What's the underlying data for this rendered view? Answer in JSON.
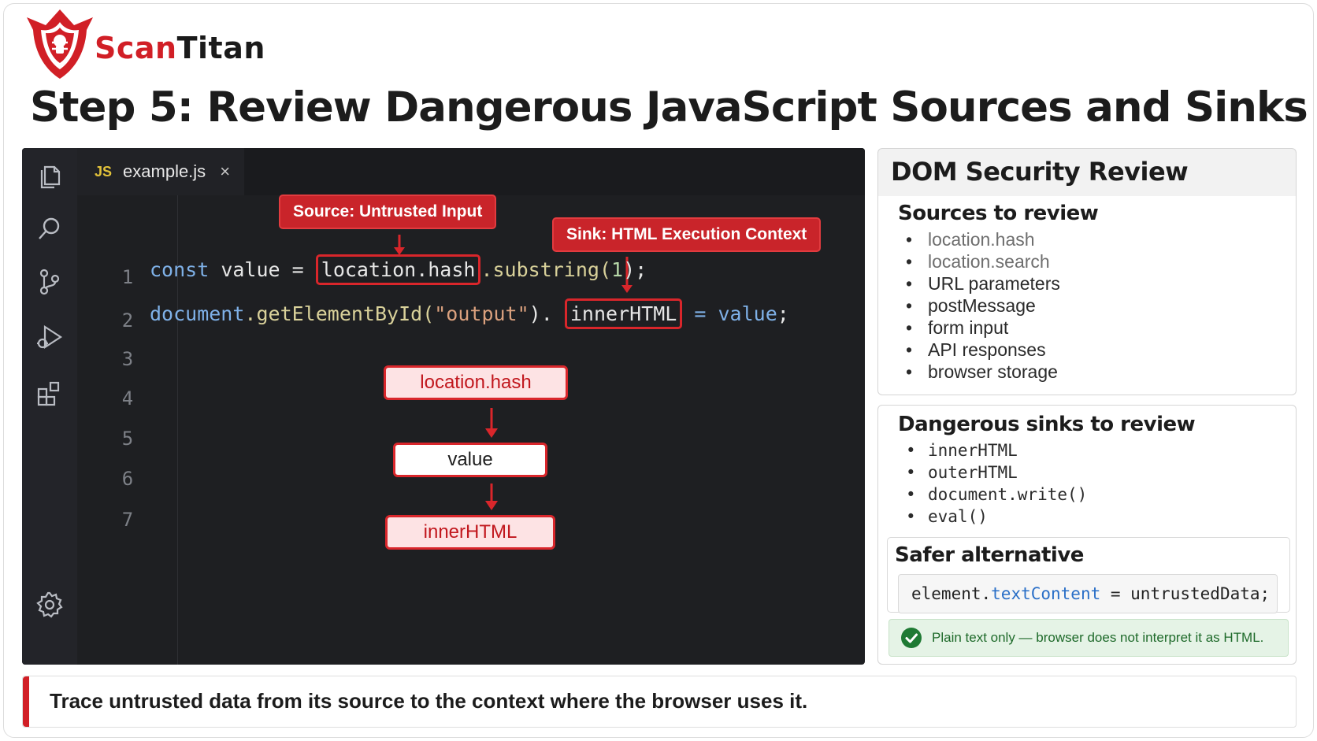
{
  "brand": {
    "name_part1": "Scan",
    "name_part2": "Titan",
    "shield_icon": "shield-bug-icon"
  },
  "title": "Step 5: Review Dangerous JavaScript Sources and Sinks",
  "editor": {
    "tab": {
      "lang_badge": "JS",
      "filename": "example.js",
      "close_glyph": "×"
    },
    "activity_icons": [
      "explorer-icon",
      "search-icon",
      "source-control-icon",
      "run-debug-icon",
      "extensions-icon",
      "settings-gear-icon"
    ],
    "line_numbers": [
      "1",
      "2",
      "3",
      "4",
      "5",
      "6",
      "7"
    ],
    "line1": {
      "kw": "const",
      "var": "value",
      "eq": "=",
      "hl": "location.hash",
      "fn": ".substring(",
      "num": "1",
      "end": ");"
    },
    "line2": {
      "obj": "document",
      "fn": ".getElementById(",
      "str": "\"output\"",
      "close": ").",
      "hl": "innerHTML",
      "eq": "=",
      "var": "value",
      "end": ";"
    },
    "callouts": {
      "source": "Source: Untrusted Input",
      "sink": "Sink: HTML Execution Context"
    },
    "flow": {
      "step1": "location.hash",
      "step2": "value",
      "step3": "innerHTML"
    }
  },
  "panel": {
    "title": "DOM Security Review",
    "sources_title": "Sources to review",
    "sources": [
      "location.hash",
      "location.search",
      "URL parameters",
      "postMessage",
      "form input",
      "API responses",
      "browser storage"
    ],
    "sinks_title": "Dangerous sinks to review",
    "sinks": [
      "innerHTML",
      "outerHTML",
      "document.write()",
      "eval()"
    ],
    "safer_title": "Safer alternative",
    "safer_code": {
      "obj": "element.",
      "prop": "textContent",
      "rest": " = untrustedData;"
    },
    "ok_text": "Plain text only — browser does not interpret it as HTML.",
    "ok_icon": "check-circle-icon"
  },
  "footer": "Trace untrusted data from its source to the context where the browser uses it.",
  "colors": {
    "brand_red": "#d11f26",
    "editor_bg": "#1e1f22",
    "ok_green": "#1e6a2a"
  }
}
